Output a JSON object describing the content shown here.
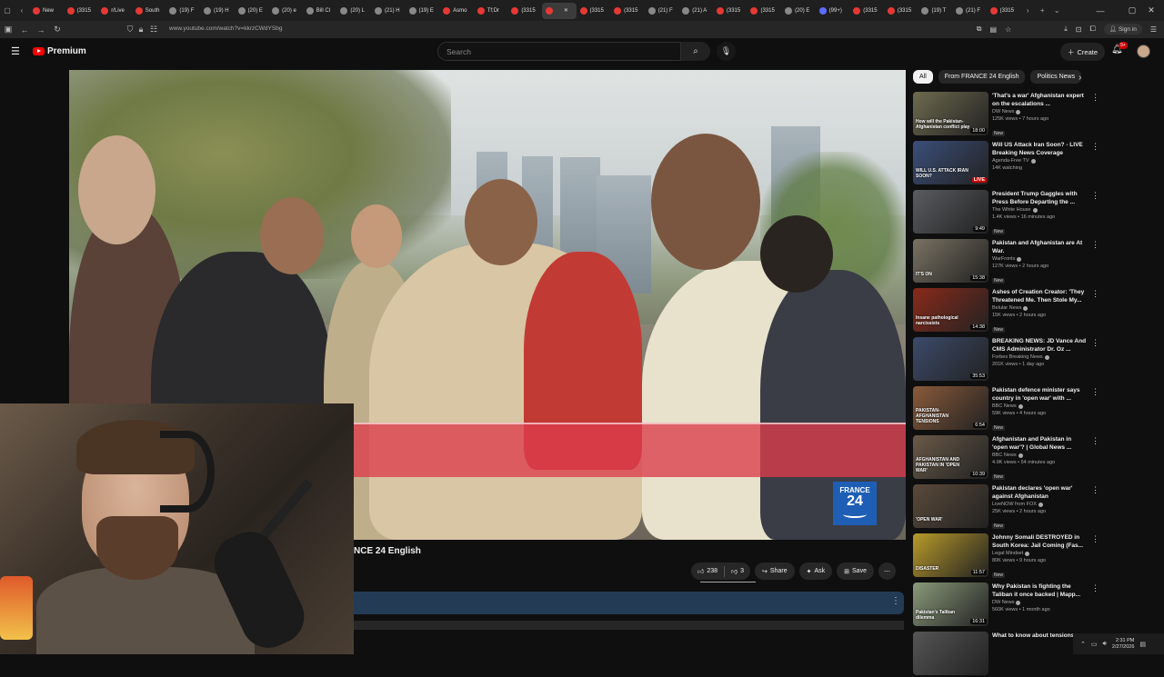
{
  "browser": {
    "tabs": [
      {
        "label": "New",
        "favicon": "red"
      },
      {
        "label": "(3315",
        "favicon": "red"
      },
      {
        "label": "r/Live",
        "favicon": "red"
      },
      {
        "label": "South",
        "favicon": "red"
      },
      {
        "label": "(19) F",
        "favicon": "gray"
      },
      {
        "label": "(19) H",
        "favicon": "gray"
      },
      {
        "label": "(20) E",
        "favicon": "gray"
      },
      {
        "label": "(20) e",
        "favicon": "gray"
      },
      {
        "label": "Bill Cl",
        "favicon": "gray"
      },
      {
        "label": "(20) L",
        "favicon": "gray"
      },
      {
        "label": "(21) H",
        "favicon": "gray"
      },
      {
        "label": "(19) E",
        "favicon": "gray"
      },
      {
        "label": "Asmo",
        "favicon": "red"
      },
      {
        "label": "Tf;Dr",
        "favicon": "red"
      },
      {
        "label": "(3315",
        "favicon": "red"
      },
      {
        "label": "",
        "favicon": "red",
        "active": true
      },
      {
        "label": "(3315",
        "favicon": "red"
      },
      {
        "label": "(3315",
        "favicon": "red"
      },
      {
        "label": "(21) F",
        "favicon": "gray"
      },
      {
        "label": "(21) A",
        "favicon": "gray"
      },
      {
        "label": "(3315",
        "favicon": "red"
      },
      {
        "label": "(3315",
        "favicon": "red"
      },
      {
        "label": "(20) E",
        "favicon": "gray"
      },
      {
        "label": "(99+)",
        "favicon": "blue"
      },
      {
        "label": "(3315",
        "favicon": "red"
      },
      {
        "label": "(3315",
        "favicon": "red"
      },
      {
        "label": "(19) T",
        "favicon": "gray"
      },
      {
        "label": "(21) F",
        "favicon": "gray"
      },
      {
        "label": "(3315",
        "favicon": "red"
      }
    ],
    "url": "www.youtube.com/watch?v=kkrzCWdYSbg",
    "signin_label": "Sign in"
  },
  "header": {
    "brand": "Premium",
    "search_placeholder": "Search",
    "create_label": "Create",
    "notif_count": "9+"
  },
  "video": {
    "channel_title_visible": "NCE 24 English",
    "logo_line1": "FRANCE",
    "logo_line2": "24",
    "likes": "238",
    "dislikes": "3",
    "share_label": "Share",
    "ask_label": "Ask",
    "save_label": "Save"
  },
  "sidebar": {
    "chips": [
      "All",
      "From FRANCE 24 English",
      "Politics News"
    ],
    "items": [
      {
        "title": "'That's a war' Afghanistan expert on the escalations ...",
        "channel": "DW News",
        "meta": "125K views • 7 hours ago",
        "duration": "18:00",
        "badge": "New",
        "thumb_text": "How will the Pakistan-Afghanistan conflict play",
        "thumb_color": "#6e6a4f"
      },
      {
        "title": "Will US Attack Iran Soon? - LIVE Breaking News Coverage",
        "channel": "Agenda-Free TV",
        "meta": "14K watching",
        "live": "LIVE",
        "badge": "",
        "thumb_text": "WILL U.S. ATTACK IRAN SOON?",
        "thumb_color": "#3b4f7a"
      },
      {
        "title": "President Trump Gaggles with Press Before Departing the ...",
        "channel": "The White House",
        "meta": "1.4K views • 16 minutes ago",
        "duration": "9:49",
        "badge": "New",
        "thumb_text": "",
        "thumb_color": "#5a5c60"
      },
      {
        "title": "Pakistan and Afghanistan are At War.",
        "channel": "WarFronts",
        "meta": "127K views • 2 hours ago",
        "duration": "15:38",
        "badge": "New",
        "thumb_text": "IT'S ON",
        "thumb_color": "#7a7263"
      },
      {
        "title": "Ashes of Creation Creator: 'They Threatened Me. Then Stole My...",
        "channel": "Belular News",
        "meta": "15K views • 2 hours ago",
        "duration": "14:38",
        "badge": "New",
        "thumb_text": "Insane pathological narcissists",
        "thumb_color": "#8a2a1a"
      },
      {
        "title": "BREAKING NEWS: JD Vance And CMS Administrator Dr. Oz ...",
        "channel": "Forbes Breaking News",
        "meta": "201K views • 1 day ago",
        "duration": "35:53",
        "badge": "",
        "thumb_text": "",
        "thumb_color": "#3c4a6a"
      },
      {
        "title": "Pakistan defence minister says country in 'open war' with ...",
        "channel": "BBC News",
        "meta": "59K views • 4 hours ago",
        "duration": "6:54",
        "badge": "New",
        "thumb_text": "PAKISTAN-AFGHANISTAN TENSIONS",
        "thumb_color": "#8a5a3a"
      },
      {
        "title": "Afghanistan and Pakistan in 'open war'? | Global News ...",
        "channel": "BBC News",
        "meta": "4.9K views • 54 minutes ago",
        "duration": "10:39",
        "badge": "New",
        "thumb_text": "AFGHANISTAN AND PAKISTAN IN 'OPEN WAR'",
        "thumb_color": "#6a5a48"
      },
      {
        "title": "Pakistan declares 'open war' against Afghanistan",
        "channel": "LiveNOW from FOX",
        "meta": "25K views • 2 hours ago",
        "duration": "",
        "badge": "New",
        "thumb_text": "'OPEN WAR'",
        "thumb_color": "#5a4a3a"
      },
      {
        "title": "Johnny Somali DESTROYED in South Korea: Jail Coming (Fas...",
        "channel": "Legal Mindset",
        "meta": "80K views • 9 hours ago",
        "duration": "11:57",
        "badge": "New",
        "thumb_text": "DISASTER",
        "thumb_color": "#b89a2a"
      },
      {
        "title": "Why Pakistan is fighting the Taliban it once backed | Mapp...",
        "channel": "DW News",
        "meta": "560K views • 1 month ago",
        "duration": "16:31",
        "badge": "",
        "thumb_text": "Pakistan's Taliban dilemma",
        "thumb_color": "#8a9a7a"
      },
      {
        "title": "What to know about tensions ...",
        "channel": "",
        "meta": "",
        "duration": "",
        "badge": "",
        "thumb_text": "",
        "thumb_color": "#555"
      }
    ]
  },
  "taskbar": {
    "time": "2:31 PM",
    "date": "2/27/2026"
  }
}
